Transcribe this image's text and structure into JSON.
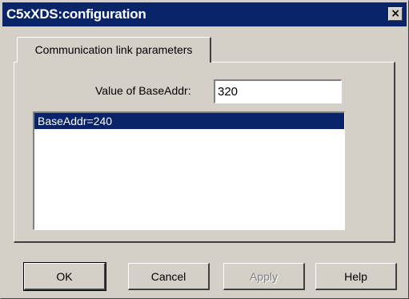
{
  "window": {
    "title": "C5xXDS:configuration",
    "close_label": "×"
  },
  "tabs": [
    {
      "label": "Communication link parameters",
      "active": true
    }
  ],
  "form": {
    "field_label": "Value of BaseAddr:",
    "field_value": "320"
  },
  "list": {
    "items": [
      {
        "label": "BaseAddr=240",
        "selected": true
      }
    ]
  },
  "buttons": {
    "ok": "OK",
    "cancel": "Cancel",
    "apply": "Apply",
    "help": "Help"
  },
  "colors": {
    "titlebar": "#0a246a",
    "face": "#d4d0c8",
    "selection": "#0a246a"
  }
}
